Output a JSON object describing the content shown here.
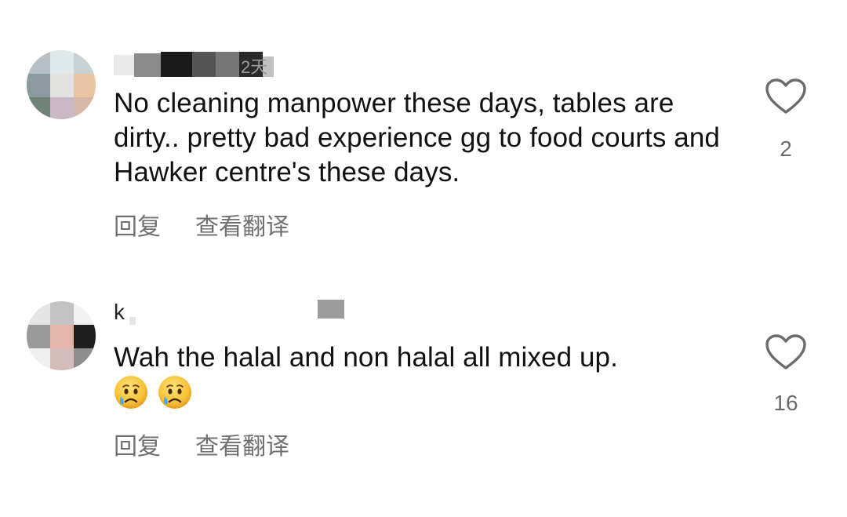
{
  "comments": [
    {
      "username": "",
      "timestamp": "2天",
      "text": "No cleaning manpower these days, tables are dirty.. pretty bad experience gg to food courts and Hawker centre's these days.",
      "reply_label": "回复",
      "translate_label": "查看翻译",
      "like_count": "2",
      "like_icon": "heart-outline-icon"
    },
    {
      "username": "k",
      "text": "Wah the halal and non halal all mixed up.",
      "emojis": [
        "crying-face-emoji",
        "crying-face-emoji"
      ],
      "reply_label": "回复",
      "translate_label": "查看翻译",
      "like_count": "16",
      "like_icon": "heart-outline-icon"
    }
  ],
  "colors": {
    "text": "#111111",
    "secondary": "#707070",
    "icon": "#6b6b6b"
  }
}
